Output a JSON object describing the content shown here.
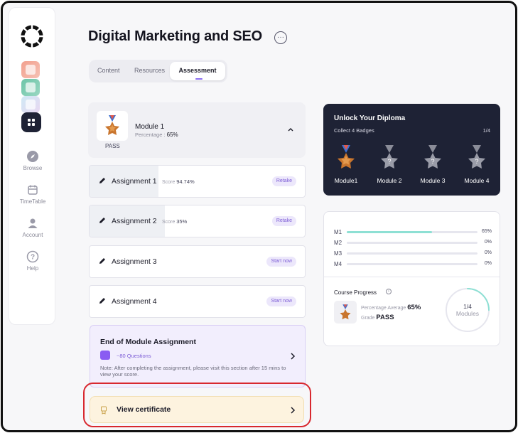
{
  "page": {
    "title": "Digital Marketing and SEO",
    "more_label": "···"
  },
  "sidebar": {
    "items": [
      {
        "label": "Browse",
        "icon": "compass-icon"
      },
      {
        "label": "TimeTable",
        "icon": "calendar-icon"
      },
      {
        "label": "Account",
        "icon": "user-icon"
      },
      {
        "label": "Help",
        "icon": "help-icon"
      }
    ]
  },
  "tabs": [
    {
      "label": "Content"
    },
    {
      "label": "Resources"
    },
    {
      "label": "Assessment",
      "active": true
    }
  ],
  "module": {
    "name": "Module 1",
    "percentage_label": "Percentage :",
    "percentage_value": "65%",
    "status": "PASS"
  },
  "assignments": [
    {
      "name": "Assignment 1",
      "score_label": "Score",
      "score": "94.74%",
      "action": "Retake",
      "progress": 0.32
    },
    {
      "name": "Assignment 2",
      "score_label": "Score",
      "score": "35%",
      "action": "Retake",
      "progress": 0.35
    },
    {
      "name": "Assignment 3",
      "score_label": "",
      "score": "",
      "action": "Start now",
      "progress": 0
    },
    {
      "name": "Assignment 4",
      "score_label": "",
      "score": "",
      "action": "Start now",
      "progress": 0
    }
  ],
  "end_of_module": {
    "title": "End of Module Assignment",
    "questions": "~80 Questions",
    "note": "Note: After completing the assignment, please visit this section after 15 mins to view your score."
  },
  "certificate": {
    "label": "View certificate"
  },
  "diploma": {
    "title": "Unlock Your Diploma",
    "subtitle": "Collect 4 Badges",
    "count": "1/4",
    "badges": [
      {
        "label": "Module1",
        "unlocked": true
      },
      {
        "label": "Module 2",
        "unlocked": false
      },
      {
        "label": "Module 3",
        "unlocked": false
      },
      {
        "label": "Module 4",
        "unlocked": false
      }
    ]
  },
  "progress": {
    "rows": [
      {
        "label": "M1",
        "value": "65%",
        "fraction": 0.65
      },
      {
        "label": "M2",
        "value": "0%",
        "fraction": 0
      },
      {
        "label": "M3",
        "value": "0%",
        "fraction": 0
      },
      {
        "label": "M4",
        "value": "0%",
        "fraction": 0
      }
    ],
    "course_title": "Course Progress",
    "avg_label": "Percentage Average",
    "avg_value": "65%",
    "grade_label": "Grade",
    "grade_value": "PASS",
    "ring_top": "1/4",
    "ring_bottom": "Modules",
    "ring_fraction": 0.25
  },
  "colors": {
    "accent": "#7c5cd6",
    "dark": "#1e2235",
    "progress_fill": "#8ee0d4",
    "highlight_ring": "#d8282f"
  }
}
